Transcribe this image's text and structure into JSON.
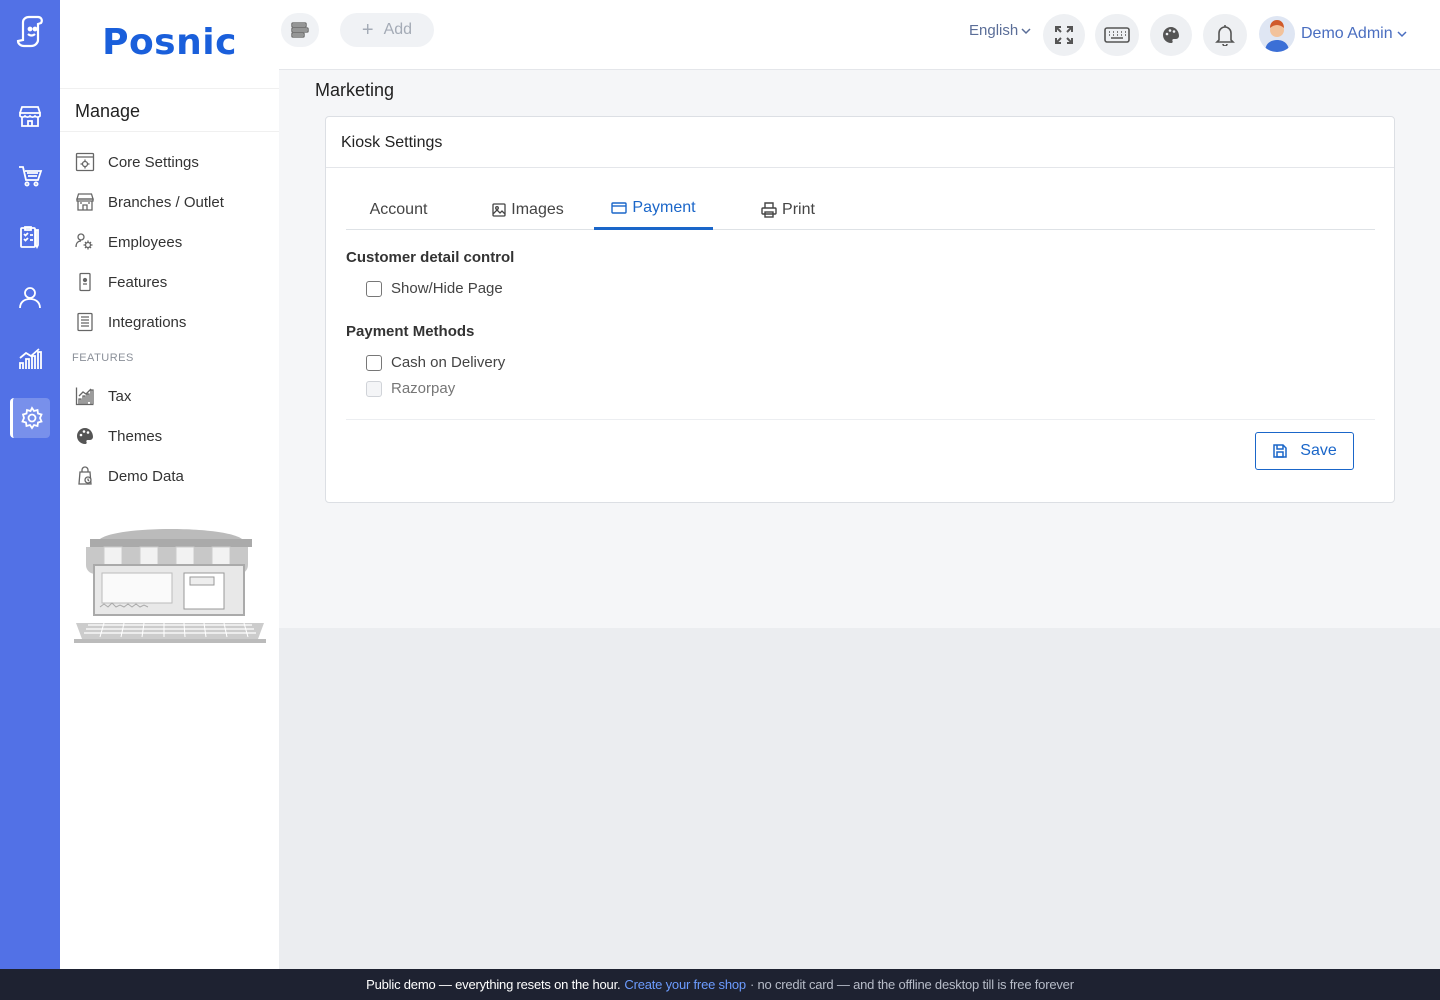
{
  "brand": {
    "name": "Posnic"
  },
  "sidebar": {
    "section_title": "Manage",
    "items": [
      {
        "label": "Core Settings",
        "icon": "core-settings-icon"
      },
      {
        "label": "Branches / Outlet",
        "icon": "branches-icon"
      },
      {
        "label": "Employees",
        "icon": "employees-icon"
      },
      {
        "label": "Features",
        "icon": "features-icon"
      },
      {
        "label": "Integrations",
        "icon": "integrations-icon"
      }
    ],
    "features_label": "FEATURES",
    "feature_items": [
      {
        "label": "Tax",
        "icon": "tax-icon"
      },
      {
        "label": "Themes",
        "icon": "themes-icon"
      },
      {
        "label": "Demo Data",
        "icon": "demo-data-icon"
      }
    ]
  },
  "rail": {
    "icons": [
      "store-icon",
      "cart-icon",
      "checklist-icon",
      "user-icon",
      "analytics-icon",
      "settings-icon"
    ],
    "active": "settings-icon"
  },
  "topbar": {
    "add_label": "Add",
    "language": "English",
    "user_name": "Demo Admin"
  },
  "page": {
    "title": "Marketing"
  },
  "card": {
    "title": "Kiosk Settings",
    "tabs": [
      {
        "label": "Account"
      },
      {
        "label": "Images"
      },
      {
        "label": "Payment"
      },
      {
        "label": "Print"
      }
    ],
    "active_tab": "Payment",
    "customer_section": {
      "title": "Customer detail control",
      "options": [
        {
          "label": "Show/Hide Page",
          "checked": false,
          "disabled": false
        }
      ]
    },
    "payment_section": {
      "title": "Payment Methods",
      "options": [
        {
          "label": "Cash on Delivery",
          "checked": false,
          "disabled": false
        },
        {
          "label": "Razorpay",
          "checked": false,
          "disabled": true
        }
      ]
    },
    "save_label": "Save"
  },
  "footer": {
    "text": "Public demo — everything resets on the hour.",
    "link": "Create your free shop",
    "suffix": "· no credit card — and the offline desktop till is free forever"
  },
  "colors": {
    "rail": "#5271e6",
    "brand": "#1a5fdb",
    "accent": "#1a66c9",
    "footer_bg": "#1e2231"
  }
}
